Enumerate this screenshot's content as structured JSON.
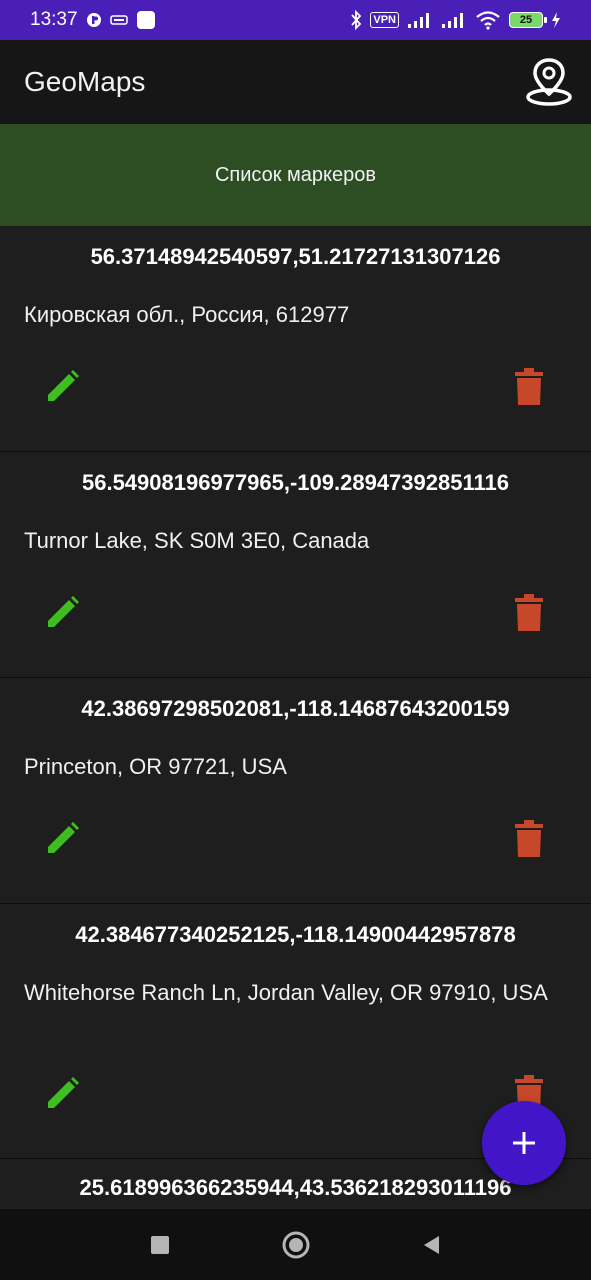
{
  "status_bar": {
    "time": "13:37",
    "vpn": "VPN",
    "battery": "25",
    "icons": [
      "notification-app-icon",
      "keyboard-icon",
      "app-square-icon",
      "bluetooth-icon",
      "vpn-icon",
      "signal-icon",
      "signal-icon",
      "wifi-icon",
      "battery-icon",
      "charging-icon"
    ]
  },
  "app_bar": {
    "title": "GeoMaps",
    "action_icon": "map-marker-icon"
  },
  "section_header": {
    "title": "Список маркеров"
  },
  "markers": [
    {
      "coords": "56.37148942540597,51.21727131307126",
      "address": "Кировская обл., Россия, 612977"
    },
    {
      "coords": "56.54908196977965,-109.28947392851116",
      "address": "Turnor Lake, SK S0M 3E0, Canada"
    },
    {
      "coords": "42.38697298502081,-118.14687643200159",
      "address": "Princeton, OR 97721, USA"
    },
    {
      "coords": "42.384677340252125,-118.14900442957878",
      "address": "Whitehorse Ranch Ln, Jordan Valley, OR 97910, USA"
    },
    {
      "coords": "25.618996366235944,43.536218293011196",
      "address": ""
    }
  ],
  "colors": {
    "status_bar": "#4a1fb8",
    "header_green": "#2d4e23",
    "edit": "#3fbf1f",
    "delete": "#c7472a",
    "fab": "#4216c8"
  },
  "fab": {
    "icon": "add-icon"
  },
  "nav": {
    "icons": [
      "recents-square-icon",
      "home-circle-icon",
      "back-triangle-icon"
    ]
  }
}
